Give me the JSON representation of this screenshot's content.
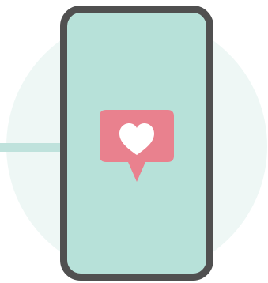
{
  "illustration": {
    "background_circle": {
      "color": "#eef7f5"
    },
    "accent_line": {
      "color": "#bfe2dc"
    },
    "phone": {
      "screen_color": "#b7e1d9",
      "frame_color": "#505050"
    },
    "like_notification": {
      "bubble_color": "#e9818e",
      "icon": "heart-icon",
      "heart_color": "#ffffff"
    }
  }
}
